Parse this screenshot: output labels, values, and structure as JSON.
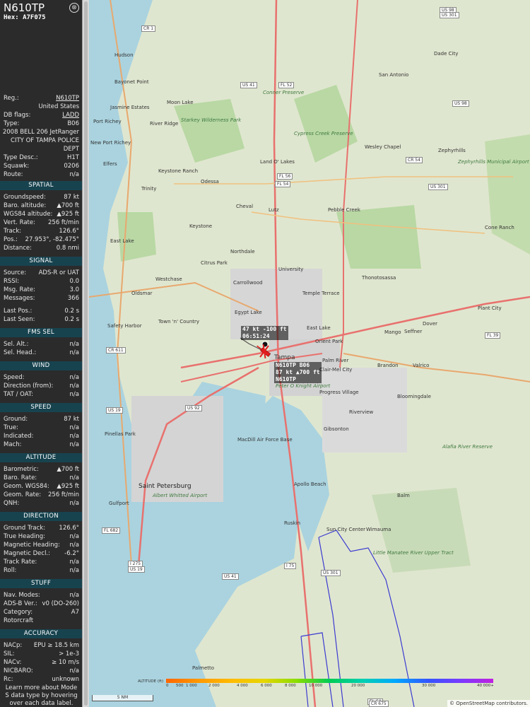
{
  "aircraft": {
    "callsign": "N610TP",
    "hex_label": "Hex: A7F075",
    "close_glyph": "⊗"
  },
  "info": [
    {
      "k": "Reg.:",
      "v": "N610TP",
      "link": true
    },
    {
      "k": "",
      "v": "United States"
    },
    {
      "k": "DB flags:",
      "v": "LADD",
      "link": true
    },
    {
      "k": "Type:",
      "v": "B06"
    },
    {
      "k": "",
      "v": "2008 BELL 206 JetRanger"
    },
    {
      "k": "",
      "v": "CITY OF TAMPA POLICE"
    },
    {
      "k": "",
      "v": "DEPT"
    },
    {
      "k": "Type Desc.:",
      "v": "H1T"
    },
    {
      "k": "Squawk:",
      "v": "0206"
    },
    {
      "k": "Route:",
      "v": "n/a"
    }
  ],
  "spatial": {
    "title": "SPATIAL",
    "rows": [
      {
        "k": "Groundspeed:",
        "v": "87 kt"
      },
      {
        "k": "Baro. altitude:",
        "v": "▲700 ft"
      },
      {
        "k": "WGS84 altitude:",
        "v": "▲925 ft"
      },
      {
        "k": "Vert. Rate:",
        "v": "256 ft/min"
      },
      {
        "k": "Track:",
        "v": "126.6°"
      },
      {
        "k": "Pos.:",
        "v": "27.953°, -82.475°"
      },
      {
        "k": "Distance:",
        "v": "0.8 nmi"
      }
    ]
  },
  "signal": {
    "title": "SIGNAL",
    "rows": [
      {
        "k": "Source:",
        "v": "ADS-R or UAT"
      },
      {
        "k": "RSSI:",
        "v": "0.0"
      },
      {
        "k": "Msg. Rate:",
        "v": "3.0"
      },
      {
        "k": "Messages:",
        "v": "366"
      },
      {
        "k": "Last Pos.:",
        "v": "0.2 s"
      },
      {
        "k": "Last Seen:",
        "v": "0.2 s"
      }
    ]
  },
  "fms": {
    "title": "FMS SEL",
    "rows": [
      {
        "k": "Sel. Alt.:",
        "v": "n/a"
      },
      {
        "k": "Sel. Head.:",
        "v": "n/a"
      }
    ]
  },
  "wind": {
    "title": "WIND",
    "rows": [
      {
        "k": "Speed:",
        "v": "n/a"
      },
      {
        "k": "Direction (from):",
        "v": "n/a"
      },
      {
        "k": "TAT / OAT:",
        "v": "n/a"
      }
    ]
  },
  "speed": {
    "title": "SPEED",
    "rows": [
      {
        "k": "Ground:",
        "v": "87 kt"
      },
      {
        "k": "True:",
        "v": "n/a"
      },
      {
        "k": "Indicated:",
        "v": "n/a"
      },
      {
        "k": "Mach:",
        "v": "n/a"
      }
    ]
  },
  "altitude": {
    "title": "ALTITUDE",
    "rows": [
      {
        "k": "Barometric:",
        "v": "▲700 ft"
      },
      {
        "k": "Baro. Rate:",
        "v": "n/a"
      },
      {
        "k": "Geom. WGS84:",
        "v": "▲925 ft"
      },
      {
        "k": "Geom. Rate:",
        "v": "256 ft/min"
      },
      {
        "k": "QNH:",
        "v": "n/a"
      }
    ]
  },
  "direction": {
    "title": "DIRECTION",
    "rows": [
      {
        "k": "Ground Track:",
        "v": "126.6°"
      },
      {
        "k": "True Heading:",
        "v": "n/a"
      },
      {
        "k": "Magnetic Heading:",
        "v": "n/a"
      },
      {
        "k": "Magnetic Decl.:",
        "v": "-6.2°"
      },
      {
        "k": "Track Rate:",
        "v": "n/a"
      },
      {
        "k": "Roll:",
        "v": "n/a"
      }
    ]
  },
  "stuff": {
    "title": "STUFF",
    "rows": [
      {
        "k": "Nav. Modes:",
        "v": "n/a"
      },
      {
        "k": "ADS-B Ver.:",
        "v": "v0 (DO-260)"
      },
      {
        "k": "Category:",
        "v": "A7"
      },
      {
        "k": "Rotorcraft",
        "v": ""
      }
    ]
  },
  "accuracy": {
    "title": "ACCURACY",
    "rows": [
      {
        "k": "NACp:",
        "v": "EPU ≥ 18.5 km"
      },
      {
        "k": "SIL:",
        "v": "> 1e-3"
      },
      {
        "k": "NACv:",
        "v": "≥ 10 m/s"
      },
      {
        "k": "NICBARO:",
        "v": "n/a"
      },
      {
        "k": "Rc:",
        "v": "unknown"
      }
    ]
  },
  "footer_text": "Learn more about Mode S data type by hovering over each data label.",
  "map": {
    "places": [
      [
        "Hudson"
      ],
      [
        "Bayonet Point"
      ],
      [
        "Moon Lake"
      ],
      [
        "Jasmine Estates"
      ],
      [
        "Port Richey"
      ],
      [
        "River Ridge"
      ],
      [
        "Starkey Wilderness Park"
      ],
      [
        "San Antonio"
      ],
      [
        "Dade City"
      ],
      [
        "Zephyrhills"
      ],
      [
        "Wesley Chapel"
      ],
      [
        "Land O' Lakes"
      ],
      [
        "New Port Richey"
      ],
      [
        "Elfers"
      ],
      [
        "Trinity"
      ],
      [
        "Odessa"
      ],
      [
        "Keystone Ranch"
      ],
      [
        "Cheval"
      ],
      [
        "Lutz"
      ],
      [
        "Pebble Creek"
      ],
      [
        "Cone Ranch"
      ],
      [
        "East Lake"
      ],
      [
        "Keystone"
      ],
      [
        "Northdale"
      ],
      [
        "Citrus Park"
      ],
      [
        "University"
      ],
      [
        "Westchase"
      ],
      [
        "Carrollwood"
      ],
      [
        "Temple Terrace"
      ],
      [
        "Thonotosassa"
      ],
      [
        "Oldsmar"
      ],
      [
        "Egypt Lake"
      ],
      [
        "Safety Harbor"
      ],
      [
        "Town 'n' Country"
      ],
      [
        "East Lake"
      ],
      [
        "Mango"
      ],
      [
        "Seffner"
      ],
      [
        "Dover"
      ],
      [
        "Plant City"
      ],
      [
        "Orient Park"
      ],
      [
        "Tampa"
      ],
      [
        "Palm River"
      ],
      [
        "Clair-Mel City"
      ],
      [
        "Brandon"
      ],
      [
        "Valrico"
      ],
      [
        "Progress Village"
      ],
      [
        "Bloomingdale"
      ],
      [
        "Riverview"
      ],
      [
        "Gibsonton"
      ],
      [
        "Pinellas Park"
      ],
      [
        "MacDill Air Force Base"
      ],
      [
        "Apollo Beach"
      ],
      [
        "Saint Petersburg"
      ],
      [
        "Gulfport"
      ],
      [
        "Balm"
      ],
      [
        "Ruskin"
      ],
      [
        "Sun City Center"
      ],
      [
        "Wimauma"
      ],
      [
        "Palmetto"
      ],
      [
        "Cypress Creek Preserve"
      ],
      [
        "Conner Preserve"
      ],
      [
        "Alafia River Reserve"
      ],
      [
        "Little Manatee River Upper Tract"
      ],
      [
        "Peter O Knight Airport"
      ],
      [
        "Albert Whitted Airport"
      ],
      [
        "Zephyrhills Municipal Airport"
      ]
    ],
    "shields": [
      "CR 1",
      "US 98",
      "US 301",
      "US 41",
      "FL 52",
      "US 98",
      "CR 54",
      "FL 56",
      "FL 54",
      "US 301",
      "FL 39",
      "CR 611",
      "US 19",
      "US 92",
      "I 75",
      "I 275",
      "US 19",
      "US 41",
      "US 301",
      "FL 682",
      "FL 64",
      "CR 675"
    ],
    "aircraft_label_top": [
      "47 kt  -100 ft",
      "06:51:24"
    ],
    "aircraft_label": [
      "N610TP B06",
      "87 kt  ▲700 ft",
      "N610TP"
    ],
    "legend": {
      "title": "ALTITUDE (ft)",
      "ticks": [
        "0",
        "500",
        "1 000",
        "2 000",
        "4 000",
        "6 000",
        "8 000",
        "10 000",
        "20 000",
        "30 000",
        "40 000+"
      ],
      "colors": [
        "#ff6600",
        "#ff9900",
        "#ffbb00",
        "#e6d600",
        "#88dd00",
        "#00cc55",
        "#00d0b0",
        "#00a8ff",
        "#3355ff",
        "#7a3aff",
        "#c020e0"
      ]
    },
    "scale": "5 NM",
    "attribution": "© OpenStreetMap contributors."
  }
}
